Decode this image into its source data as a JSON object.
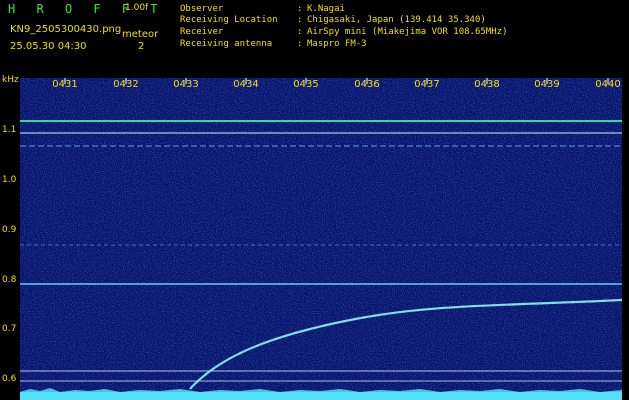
{
  "header": {
    "app_title": "H R O F F T",
    "version": "1.00f",
    "filename": "KN9_2505300430.png",
    "meteor_label": "meteor",
    "meteor_count": "2",
    "datetime": "25.05.30 04:30",
    "info": [
      {
        "label": "Observer",
        "value": "K.Nagai"
      },
      {
        "label": "Receiving Location",
        "value": "Chigasaki, Japan (139.414 35.340)"
      },
      {
        "label": "Receiver",
        "value": "AirSpy mini (Miakejima VOR 108.65MHz)"
      },
      {
        "label": "Receiving antenna",
        "value": "Maspro FM-3"
      }
    ]
  },
  "axis": {
    "unit": "kHz",
    "y_ticks": [
      "1.1",
      "1.0",
      "0.9",
      "0.8",
      "0.7",
      "0.6"
    ],
    "time_ticks": [
      "0431",
      "0432",
      "0433",
      "0434",
      "0435",
      "0436",
      "0437",
      "0438",
      "0439",
      "0440"
    ]
  },
  "colors": {
    "background": "#081a7a",
    "label": "#f0e000",
    "title": "#2dea2d",
    "signal": "#9cf2ff"
  }
}
